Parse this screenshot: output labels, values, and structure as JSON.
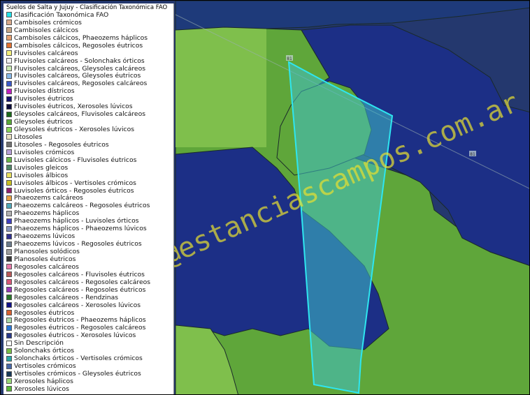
{
  "legend": {
    "title": "Suelos de Salta y Jujuy - Clasificación Taxonómica FAO",
    "items": [
      {
        "label": "Clasificación Taxonómica FAO",
        "color": "#22e0e8"
      },
      {
        "label": "Cambisoles crómicos",
        "color": "#d9a98a"
      },
      {
        "label": "Cambisoles cálcicos",
        "color": "#c9a888"
      },
      {
        "label": "Cambisoles cálcicos, Phaeozems háplicos",
        "color": "#e6a070"
      },
      {
        "label": "Cambisoles cálcicos, Regosoles éutricos",
        "color": "#e07030"
      },
      {
        "label": "Fluvisoles calcáreos",
        "color": "#f4f07a"
      },
      {
        "label": "Fluvisoles calcáreos - Solonchaks órticos",
        "color": "#f2f2f2"
      },
      {
        "label": "Fluvisoles calcáreos, Gleysoles calcáreos",
        "color": "#c8e8b0"
      },
      {
        "label": "Fluvisoles calcáreos, Gleysoles éutricos",
        "color": "#88b8e8"
      },
      {
        "label": "Fluvisoles calcáreos, Regosoles calcáreos",
        "color": "#3a58c8"
      },
      {
        "label": "Fluvisoles dístricos",
        "color": "#c020c0"
      },
      {
        "label": "Fluvisoles éutricos",
        "color": "#10106a"
      },
      {
        "label": "Fluvisoles éutricos, Xerosoles lúvicos",
        "color": "#0a0a3a"
      },
      {
        "label": "Gleysoles calcáreos, Fluvisoles calcáreos",
        "color": "#1a6a1a"
      },
      {
        "label": "Gleysoles éutricos",
        "color": "#58a838"
      },
      {
        "label": "Gleysoles éutricos - Xerosoles lúvicos",
        "color": "#88d858"
      },
      {
        "label": "Litosoles",
        "color": "#e8e0c0"
      },
      {
        "label": "Litosoles - Regosoles éutricos",
        "color": "#707070"
      },
      {
        "label": "Luvisoles crómicos",
        "color": "#b8a0d8"
      },
      {
        "label": "Luvisoles cálcicos - Fluvisoles éutricos",
        "color": "#68b848"
      },
      {
        "label": "Luvisoles gleicos",
        "color": "#508868"
      },
      {
        "label": "Luvisoles álbicos",
        "color": "#e8e060"
      },
      {
        "label": "Luvisoles álbicos - Vertisoles crómicos",
        "color": "#c8c020"
      },
      {
        "label": "Luvisoles órticos - Regosoles éutricos",
        "color": "#902070"
      },
      {
        "label": "Phaeozems calcáreos",
        "color": "#e8a040"
      },
      {
        "label": "Phaeozems calcáreos - Regosoles éutricos",
        "color": "#50a8b8"
      },
      {
        "label": "Phaeozems háplicos",
        "color": "#b0b0b0"
      },
      {
        "label": "Phaeozems háplicos - Luvisoles órticos",
        "color": "#4040c0"
      },
      {
        "label": "Phaeozems háplicos - Phaeozems lúvicos",
        "color": "#8898c0"
      },
      {
        "label": "Phaeozems lúvicos",
        "color": "#303090"
      },
      {
        "label": "Phaeozems lúvicos - Regosoles éutricos",
        "color": "#6a7a8a"
      },
      {
        "label": "Planosoles solódicos",
        "color": "#a0a0a0"
      },
      {
        "label": "Planosoles éutricos",
        "color": "#383838"
      },
      {
        "label": "Regosoles calcáreos",
        "color": "#e878a8"
      },
      {
        "label": "Regosoles calcáreos - Fluvisoles éutricos",
        "color": "#b85858"
      },
      {
        "label": "Regosoles calcáreos - Regosoles calcáreos",
        "color": "#d85878"
      },
      {
        "label": "Regosoles calcáreos - Regosoles éutricos",
        "color": "#9838b8"
      },
      {
        "label": "Regosoles calcáreos - Rendzinas",
        "color": "#287828"
      },
      {
        "label": "Regosoles calcáreos - Xerosoles lúvicos",
        "color": "#101088"
      },
      {
        "label": "Regosoles éutricos",
        "color": "#d86030"
      },
      {
        "label": "Regosoles éutricos - Phaeozems háplicos",
        "color": "#a8d8a8"
      },
      {
        "label": "Regosoles éutricos - Regosoles calcáreos",
        "color": "#2878d8"
      },
      {
        "label": "Regosoles éutricos - Xerosoles lúvicos",
        "color": "#283888"
      },
      {
        "label": "Sin Descripción",
        "color": "#ffffff"
      },
      {
        "label": "Solonchaks órticos",
        "color": "#78c048"
      },
      {
        "label": "Solonchaks órticos - Vertisoles crómicos",
        "color": "#28a8a8"
      },
      {
        "label": "Vertisoles crómicos",
        "color": "#4868a8"
      },
      {
        "label": "Vertisoles crómicos - Gleysoles éutricos",
        "color": "#183858"
      },
      {
        "label": "Xerosoles háplicos",
        "color": "#98d878"
      },
      {
        "label": "Xerosoles lúvicos",
        "color": "#58b838"
      }
    ]
  },
  "watermark": "info@estanciascampos.com.ar",
  "map_labels": {
    "road_marker_1": "81",
    "road_marker_2": "81"
  },
  "colors": {
    "green_soil": "#5fa63a",
    "light_green_soil": "#7fc24e",
    "navy_soil": "#1c2f86",
    "dark_navy_soil": "#22356f",
    "parcel_fill": "#3fc0c8",
    "parcel_stroke": "#2ee6f0",
    "watermark": "#e8e030"
  }
}
